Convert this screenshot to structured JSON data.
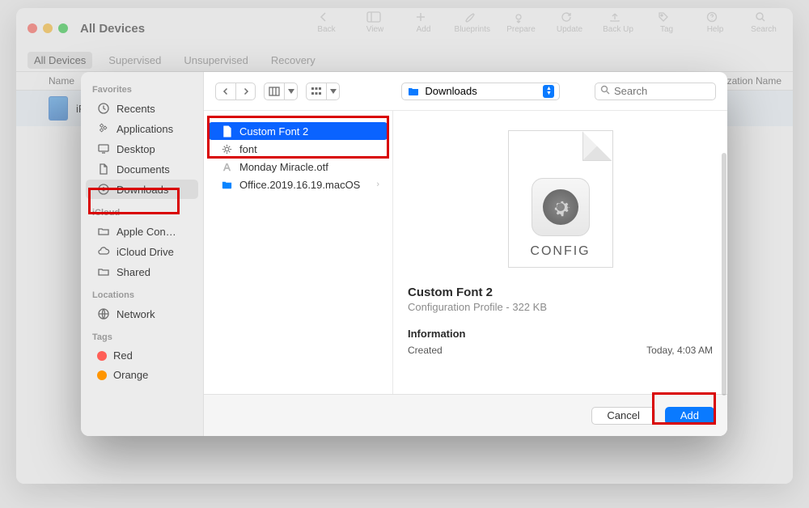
{
  "window": {
    "title": "All Devices"
  },
  "toolbar": [
    {
      "name": "back-button",
      "label": "Back",
      "icon": "chevron-left"
    },
    {
      "name": "view-button",
      "label": "View",
      "icon": "sidebar"
    },
    {
      "name": "add-button",
      "label": "Add",
      "icon": "plus"
    },
    {
      "name": "blueprints-button",
      "label": "Blueprints",
      "icon": "brush"
    },
    {
      "name": "prepare-button",
      "label": "Prepare",
      "icon": "gear-down"
    },
    {
      "name": "update-button",
      "label": "Update",
      "icon": "refresh"
    },
    {
      "name": "backup-button",
      "label": "Back Up",
      "icon": "upload"
    },
    {
      "name": "tag-button",
      "label": "Tag",
      "icon": "tag"
    },
    {
      "name": "help-button",
      "label": "Help",
      "icon": "question"
    },
    {
      "name": "search-button",
      "label": "Search",
      "icon": "search"
    }
  ],
  "filters": {
    "all": "All Devices",
    "supervised": "Supervised",
    "unsupervised": "Unsupervised",
    "recovery": "Recovery"
  },
  "table": {
    "col_name": "Name",
    "col_org": "nization Name",
    "row0": {
      "name": "iPa"
    }
  },
  "sidebar": {
    "favorites": {
      "heading": "Favorites",
      "items": [
        "Recents",
        "Applications",
        "Desktop",
        "Documents",
        "Downloads"
      ]
    },
    "icloud": {
      "heading": "iCloud",
      "items": [
        "Apple Con…",
        "iCloud Drive",
        "Shared"
      ]
    },
    "locations": {
      "heading": "Locations",
      "items": [
        "Network"
      ]
    },
    "tags": {
      "heading": "Tags",
      "items": [
        {
          "label": "Red",
          "color": "#ff5f57"
        },
        {
          "label": "Orange",
          "color": "#ff9500"
        }
      ]
    }
  },
  "dialog_toolbar": {
    "location": "Downloads",
    "search_placeholder": "Search"
  },
  "files": [
    {
      "name": "Custom Font 2",
      "icon": "doc",
      "selected": true
    },
    {
      "name": "font",
      "icon": "setting",
      "selected": false
    },
    {
      "name": "Monday Miracle.otf",
      "icon": "font",
      "selected": false
    },
    {
      "name": "Office.2019.16.19.macOS",
      "icon": "folder",
      "selected": false,
      "is_folder": true
    }
  ],
  "preview": {
    "badge": "CONFIG",
    "title": "Custom Font 2",
    "subtitle": "Configuration Profile - 322 KB",
    "info_heading": "Information",
    "created_label": "Created",
    "created_value": "Today, 4:03 AM"
  },
  "footer": {
    "cancel": "Cancel",
    "add": "Add"
  }
}
